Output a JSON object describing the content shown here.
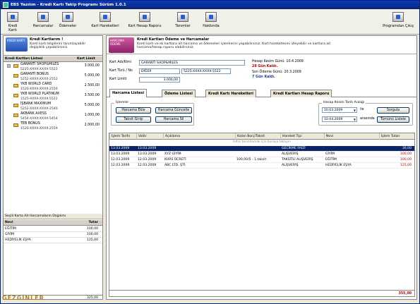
{
  "window": {
    "title": "EBS Yazılım - Kredi Kartı Takip Programı Sürüm 1.0.1"
  },
  "toolbar": [
    {
      "label": "Kredi Kartı",
      "icon": "credit-card-icon"
    },
    {
      "label": "Harcamalar",
      "icon": "expenses-icon"
    },
    {
      "label": "Ödemeler",
      "icon": "payments-icon"
    },
    {
      "label": "Kart Hareketleri",
      "icon": "card-movements-icon"
    },
    {
      "label": "Kart Hesap Raporu",
      "icon": "report-icon"
    },
    {
      "label": "Tanımlar",
      "icon": "definitions-icon"
    },
    {
      "label": "Hakkında",
      "icon": "about-icon"
    },
    {
      "label": "Programdan Çıkış",
      "icon": "exit-icon"
    }
  ],
  "left": {
    "info_title": "Kredi Kartlarım !",
    "info_desc": "Kredi kartı bilgilerini tanımlayabilir değişiklik yapabilirsiniz.",
    "card_image_text": "KREDİ KARTI",
    "col_list": "Kredi Kartları Listesi",
    "col_limit": "Kart Limit",
    "cards": [
      {
        "name": "GARANTİ SHOP&MILES",
        "number": "5225-XXXX-XXXX-5522",
        "limit": "3.000,00"
      },
      {
        "name": "GARANTİ BONUS",
        "number": "5252-XXXX-XXXX-2552",
        "limit": "5.000,00"
      },
      {
        "name": "YKB WORLD CARD",
        "number": "1520-XXXX-XXXX-2550",
        "limit": "2.500,00"
      },
      {
        "name": "YKB WORLD PLATINUM",
        "number": "1525-XXXX-XXXX-5522",
        "limit": "3.500,00"
      },
      {
        "name": "İŞBANK MAXIMUM",
        "number": "5252-XXXX-XXXX-2540",
        "limit": "5.000,00"
      },
      {
        "name": "AKBANK AXESS",
        "number": "5454-XXXX-XXXX-5454",
        "limit": "1.000,00"
      },
      {
        "name": "TEB BONUS",
        "number": "1520-XXXX-XXXX-2559",
        "limit": "2.000,00"
      }
    ],
    "cat_header": "Seçili Karta Ait Harcamaların Dağılımı",
    "cat_col_type": "Nevi",
    "cat_col_total": "Tutar",
    "categories": [
      {
        "name": "EĞİTİM",
        "amount": "100,00"
      },
      {
        "name": "GİYİM",
        "amount": "100,00"
      },
      {
        "name": "HEDİYELİK EŞYA",
        "amount": "125,00"
      }
    ],
    "cat_total": "325,00"
  },
  "right": {
    "info_title": "Kredi Kartları Ödeme ve Harcamalar",
    "info_desc": "Kredi kartı ve ek kartlara ait harcama ve ödemeleri işlemlerini yapabilirsiniz. Kart hareketlerini izleyebilir ve kartlara ait harcama/hesap raporu alabilirsiniz.",
    "card_image_text": "HARCAMA ÖDEME",
    "card_name_label": "Kart Adı/Kimi",
    "card_name_value": "GARANTİ SHOP&MILES",
    "card_type_label": "Kart Türü / No",
    "card_type_value": "DİĞER",
    "card_no_value": "5225-XXXX-XXXX-5522",
    "card_limit_label": "Kart Limiti",
    "card_limit_value": "3.000,00",
    "cut_date": "Hesap Kesim Günü: 10.4.2009",
    "cut_days": "28 Gün Kaldı.",
    "pay_date": "Son Ödeme Günü: 20.3.2009",
    "pay_days": "7 Gün Kaldı.",
    "tabs": [
      "Harcama Listesi",
      "Ödeme Listesi",
      "Kredi Kartı Hareketleri",
      "Kredi Kartları Hesap Raporu"
    ],
    "ops_label": "İşlemler",
    "btn_add": "Harcama Ekle",
    "btn_update": "Harcama Güncelle",
    "btn_installment": "Taksit Girişi",
    "btn_delete": "Harcama Sil",
    "range_label": "Hesap Kesim Tarih Aralığı",
    "date_from": "10.03.2009",
    "date_between": "ile",
    "date_to": "10.04.2009",
    "date_range_word": "arasında",
    "btn_query": "Sorgula",
    "btn_list_all": "Tümünü Listele",
    "grid_headers": [
      "İşlem Tarihi",
      "Valör",
      "Açıklama",
      "Kalan Borç/Taksit",
      "Hareket Tipi",
      "Nevi",
      "İşlem Tutarı"
    ],
    "grid_hint": "Filtre tanımlamak için buraya tıklayın",
    "rows": [
      {
        "date": "13.03.2009",
        "valor": "13.03.2009",
        "desc": "",
        "remain": "",
        "type": "GECİKME FAİZİ",
        "nevi": "",
        "amount": "30,00",
        "selected": true
      },
      {
        "date": "13.03.2009",
        "valor": "13.03.2009",
        "desc": "XYZ GİYİM",
        "remain": "",
        "type": "ALIŞVERİŞ",
        "nevi": "GİYİM",
        "amount": "100,00",
        "selected": false
      },
      {
        "date": "12.03.2009",
        "valor": "12.03.2009",
        "desc": "KURS ÜCRETİ",
        "remain": "100,00/5 - 1.taksit",
        "type": "TAKSİTLİ ALIŞVERİŞ",
        "nevi": "EĞİTİM",
        "amount": "100,00",
        "selected": false
      },
      {
        "date": "12.03.2009",
        "valor": "12.03.2009",
        "desc": "ABC LTD. ŞTİ.",
        "remain": "",
        "type": "ALIŞVERİŞ",
        "nevi": "HEDİYELİK EŞYA",
        "amount": "125,00",
        "selected": false
      }
    ],
    "grid_total": "355,00"
  },
  "watermark": "GEZGİNLER"
}
